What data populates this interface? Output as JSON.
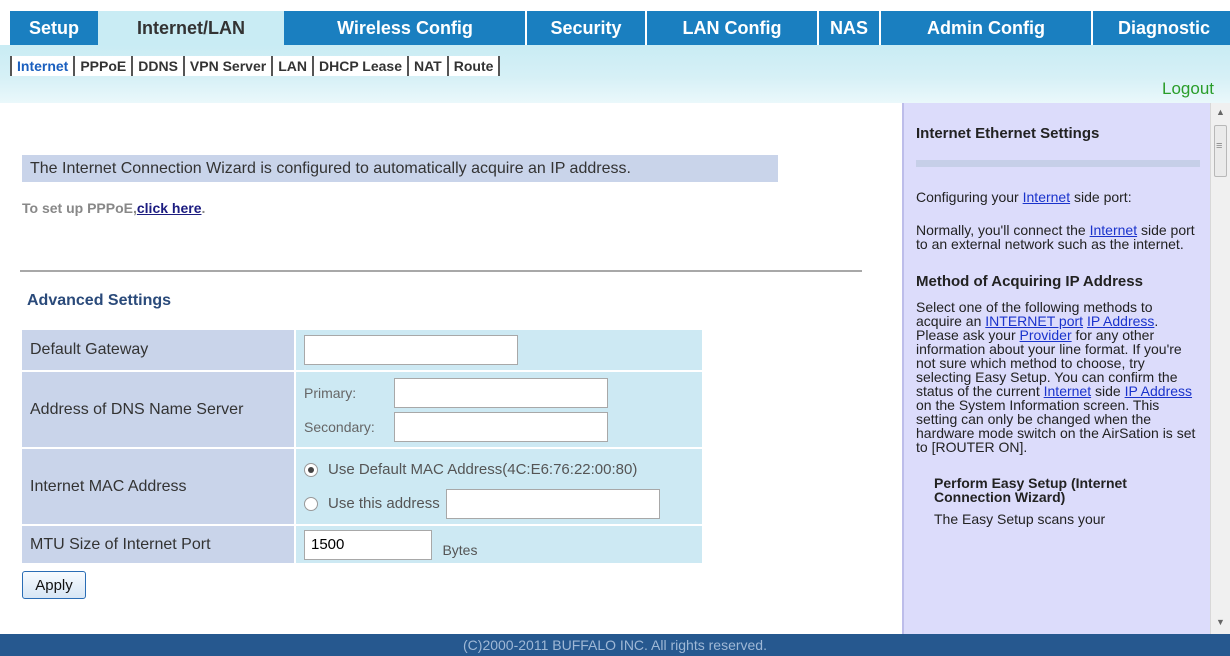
{
  "topnav": {
    "tabs": [
      {
        "label": "Setup"
      },
      {
        "label": "Internet/LAN",
        "active": true
      },
      {
        "label": "Wireless Config"
      },
      {
        "label": "Security"
      },
      {
        "label": "LAN Config"
      },
      {
        "label": "NAS"
      },
      {
        "label": "Admin Config"
      },
      {
        "label": "Diagnostic"
      }
    ]
  },
  "subnav": {
    "tabs": [
      {
        "label": "Internet",
        "active": true
      },
      {
        "label": "PPPoE"
      },
      {
        "label": "DDNS"
      },
      {
        "label": "VPN Server"
      },
      {
        "label": "LAN"
      },
      {
        "label": "DHCP Lease"
      },
      {
        "label": "NAT"
      },
      {
        "label": "Route"
      }
    ],
    "logout": "Logout"
  },
  "main": {
    "wizard_message": "The Internet Connection Wizard is configured to automatically acquire an IP address.",
    "pppoe_prefix": "To set up PPPoE,",
    "pppoe_link": "click here",
    "pppoe_suffix": ".",
    "advanced_title": "Advanced Settings",
    "rows": {
      "gateway_label": "Default Gateway",
      "gateway_value": "",
      "dns_label": "Address of DNS Name Server",
      "dns_primary_label": "Primary:",
      "dns_primary_value": "",
      "dns_secondary_label": "Secondary:",
      "dns_secondary_value": "",
      "mac_label": "Internet MAC Address",
      "mac_default_option": "Use Default MAC Address(4C:E6:76:22:00:80)",
      "mac_custom_option": "Use this address",
      "mac_custom_value": "",
      "mtu_label": "MTU Size of Internet Port",
      "mtu_value": "1500",
      "mtu_unit": "Bytes"
    },
    "apply_button": "Apply"
  },
  "help": {
    "title": "Internet Ethernet Settings",
    "p1_pre": "Configuring your ",
    "p1_link": "Internet",
    "p1_post": " side port:",
    "p2_pre": "Normally, you'll connect the ",
    "p2_link": "Internet",
    "p2_post": " side port to an external network such as the internet.",
    "method_title": "Method of Acquiring IP Address",
    "m_t1": "Select one of the following methods to acquire an ",
    "m_l1": "INTERNET port",
    "m_t2": " ",
    "m_l2": "IP Address",
    "m_t3": ". Please ask your ",
    "m_l3": "Provider",
    "m_t4": " for any other information about your line format. If you're not sure which method to choose, try selecting Easy Setup. You can confirm the status of the current ",
    "m_l4": "Internet",
    "m_t5": " side ",
    "m_l5": "IP Address",
    "m_t6": " on the System Information screen. This setting can only be changed when the hardware mode switch on the AirSation is set to [ROUTER ON].",
    "easy_title": "Perform Easy Setup (Internet Connection Wizard)",
    "easy_text": "The Easy Setup scans your"
  },
  "footer": {
    "copyright": "(C)2000-2011 BUFFALO INC. All rights reserved."
  }
}
